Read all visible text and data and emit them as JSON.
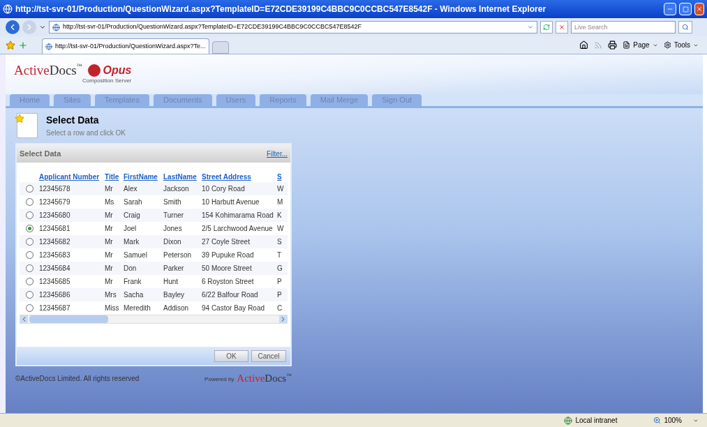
{
  "window": {
    "title": "http://tst-svr-01/Production/QuestionWizard.aspx?TemplateID=E72CDE39199C4BBC9C0CCBC547E8542F - Windows Internet Explorer"
  },
  "address": {
    "value": "http://tst-svr-01/Production/QuestionWizard.aspx?TemplateID=E72CDE39199C4BBC9C0CCBC547E8542F"
  },
  "search": {
    "placeholder": "Live Search"
  },
  "browser_tabs": [
    {
      "label": "http://tst-svr-01/Production/QuestionWizard.aspx?Te...",
      "selected": true
    }
  ],
  "command_bar": [
    "Page",
    "Tools"
  ],
  "logo": {
    "brand_part1": "Active",
    "brand_part2": "Docs",
    "trademark": "™",
    "product": "Opus",
    "subtitle": "Composition Server"
  },
  "nav_tabs": [
    "Home",
    "Sites",
    "Templates",
    "Documents",
    "Users",
    "Reports",
    "Mail Merge",
    "Sign Out"
  ],
  "page_header": {
    "title": "Select Data",
    "subtitle": "Select a row and click OK"
  },
  "panel": {
    "title": "Select Data",
    "filter_link": "Filter...",
    "columns": [
      "Applicant Number",
      "Title",
      "FirstName",
      "LastName",
      "Street Address",
      "S"
    ],
    "rows": [
      {
        "selected": false,
        "cells": [
          "12345678",
          "Mr",
          "Alex",
          "Jackson",
          "10 Cory Road",
          "W"
        ]
      },
      {
        "selected": false,
        "cells": [
          "12345679",
          "Ms",
          "Sarah",
          "Smith",
          "10 Harbutt Avenue",
          "M"
        ]
      },
      {
        "selected": false,
        "cells": [
          "12345680",
          "Mr",
          "Craig",
          "Turner",
          "154 Kohimarama Road",
          "K"
        ]
      },
      {
        "selected": true,
        "cells": [
          "12345681",
          "Mr",
          "Joel",
          "Jones",
          "2/5 Larchwood Avenue",
          "W"
        ]
      },
      {
        "selected": false,
        "cells": [
          "12345682",
          "Mr",
          "Mark",
          "Dixon",
          "27 Coyle Street",
          "S"
        ]
      },
      {
        "selected": false,
        "cells": [
          "12345683",
          "Mr",
          "Samuel",
          "Peterson",
          "39 Pupuke Road",
          "T"
        ]
      },
      {
        "selected": false,
        "cells": [
          "12345684",
          "Mr",
          "Don",
          "Parker",
          "50 Moore Street",
          "G"
        ]
      },
      {
        "selected": false,
        "cells": [
          "12345685",
          "Mr",
          "Frank",
          "Hunt",
          "6 Royston Street",
          "P"
        ]
      },
      {
        "selected": false,
        "cells": [
          "12345686",
          "Mrs",
          "Sacha",
          "Bayley",
          "6/22 Balfour Road",
          "P"
        ]
      },
      {
        "selected": false,
        "cells": [
          "12345687",
          "Miss",
          "Meredith",
          "Addison",
          "94 Castor Bay Road",
          "C"
        ]
      }
    ],
    "buttons": [
      "OK",
      "Cancel"
    ]
  },
  "footer": {
    "copyright": "©ActiveDocs Limited. All rights reserved",
    "powered_by": "Powered by",
    "brand_part1": "Active",
    "brand_part2": "Docs",
    "trademark": "™"
  },
  "status_bar": {
    "zone": "Local intranet",
    "zoom": "100%"
  }
}
